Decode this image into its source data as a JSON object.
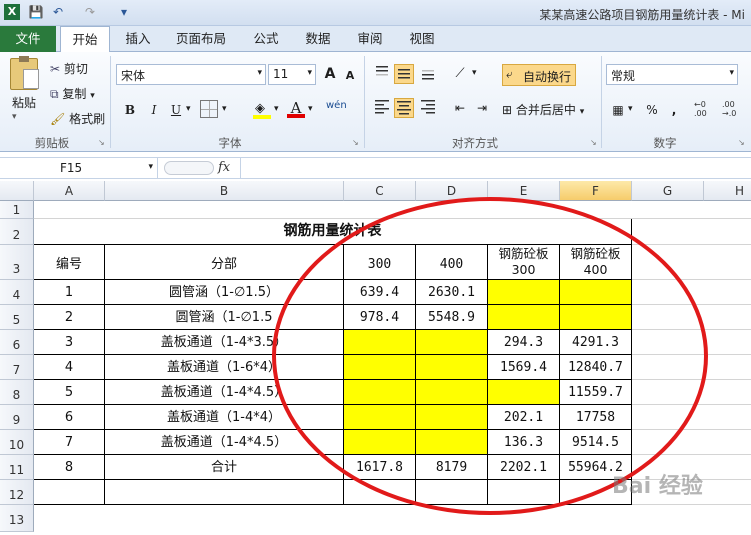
{
  "title": "某某高速公路项目钢筋用量统计表 - Mi",
  "quick_access": {
    "save": "💾",
    "undo": "↶",
    "redo": "↷",
    "more": "▾"
  },
  "tabs": [
    "文件",
    "开始",
    "插入",
    "页面布局",
    "公式",
    "数据",
    "审阅",
    "视图"
  ],
  "ribbon": {
    "clipboard": {
      "paste": "粘贴",
      "cut": "剪切",
      "copy": "复制",
      "format_painter": "格式刷",
      "label": "剪贴板"
    },
    "font": {
      "name": "宋体",
      "size": "11",
      "grow": "A",
      "shrink": "A",
      "bold": "B",
      "italic": "I",
      "underline": "U",
      "phonetic": "wén",
      "label": "字体"
    },
    "alignment": {
      "wrap_text": "自动换行",
      "merge_center": "合并后居中",
      "label": "对齐方式"
    },
    "number": {
      "format": "常规",
      "percent": "%",
      "comma": ",",
      "label": "数字"
    }
  },
  "name_box": "F15",
  "fx": "fx",
  "formula": "",
  "columns": [
    "A",
    "B",
    "C",
    "D",
    "E",
    "F",
    "G",
    "H"
  ],
  "rows": [
    "1",
    "2",
    "3",
    "4",
    "5",
    "6",
    "7",
    "8",
    "9",
    "10",
    "11",
    "12",
    "13"
  ],
  "sheet": {
    "title": "钢筋用量统计表",
    "headers": {
      "no": "编号",
      "part": "分部",
      "c": "300",
      "d": "400",
      "e": "钢筋砼板\n300",
      "f": "钢筋砼板\n400"
    },
    "data": [
      {
        "no": "1",
        "part": "圆管涵（1-∅1.5）",
        "c": "639.4",
        "d": "2630.1",
        "e": "",
        "f": ""
      },
      {
        "no": "2",
        "part": "圆管涵（1-∅1.5",
        "c": "978.4",
        "d": "5548.9",
        "e": "",
        "f": ""
      },
      {
        "no": "3",
        "part": "盖板通道（1-4*3.5）",
        "c": "",
        "d": "",
        "e": "294.3",
        "f": "4291.3"
      },
      {
        "no": "4",
        "part": "盖板通道（1-6*4）",
        "c": "",
        "d": "",
        "e": "1569.4",
        "f": "12840.7"
      },
      {
        "no": "5",
        "part": "盖板通道（1-4*4.5）",
        "c": "",
        "d": "",
        "e": "",
        "f": "11559.7"
      },
      {
        "no": "6",
        "part": "盖板通道（1-4*4）",
        "c": "",
        "d": "",
        "e": "202.1",
        "f": "17758"
      },
      {
        "no": "7",
        "part": "盖板通道（1-4*4.5）",
        "c": "",
        "d": "",
        "e": "136.3",
        "f": "9514.5"
      },
      {
        "no": "8",
        "part": "合计",
        "c": "1617.8",
        "d": "8179",
        "e": "2202.1",
        "f": "55964.2"
      }
    ]
  },
  "watermark": "Bai 经验",
  "colors": {
    "highlight": "#ffff00",
    "annotation": "#e11a1a",
    "file_tab": "#2a7a3c"
  }
}
